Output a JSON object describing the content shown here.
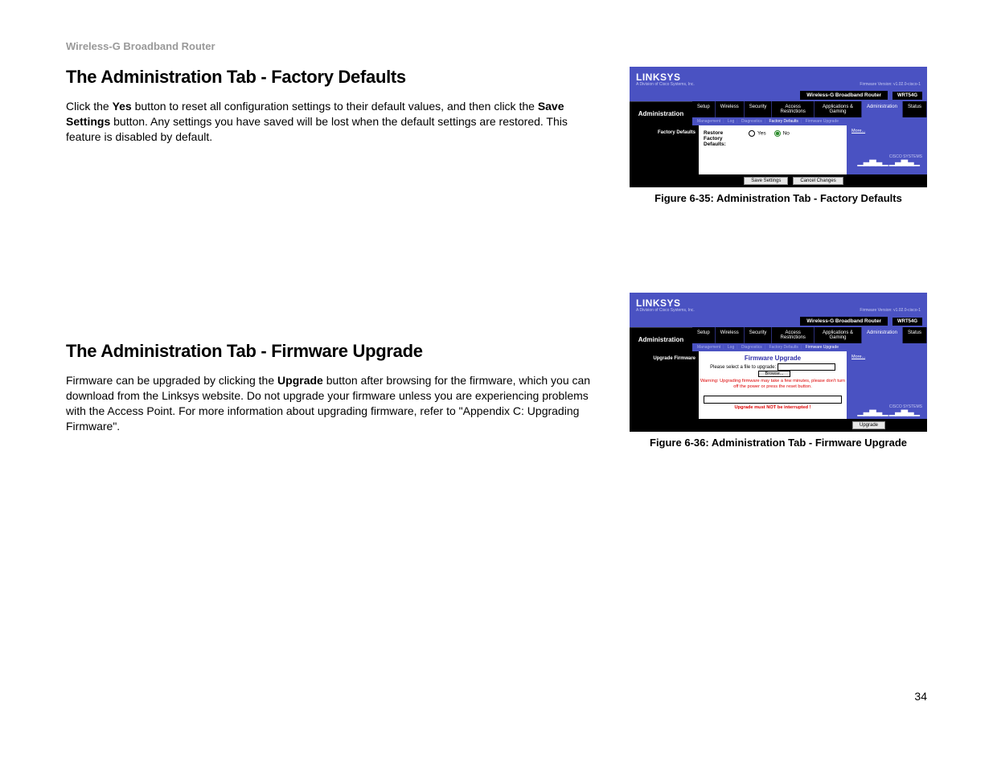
{
  "doc_header": "Wireless-G Broadband Router",
  "page_number": "34",
  "section1": {
    "title": "The Administration Tab - Factory Defaults",
    "p_pre": "Click the ",
    "p_b1": "Yes",
    "p_mid1": " button to reset all configuration settings to their default values, and then click the ",
    "p_b2": "Save Settings",
    "p_mid2": " button. Any settings you have saved will be lost when the default settings are restored. This feature is disabled by default."
  },
  "section2": {
    "title": "The Administration Tab - Firmware Upgrade",
    "p_pre": "Firmware can be upgraded by clicking the ",
    "p_b1": "Upgrade",
    "p_post": " button after browsing for the firmware, which you can download from the Linksys website. Do not upgrade your firmware unless you are experiencing problems with the Access Point. For more information about upgrading firmware, refer to \"Appendix C: Upgrading Firmware\"."
  },
  "fig1": {
    "caption": "Figure 6-35: Administration Tab - Factory Defaults",
    "logo": "LINKSYS",
    "logo_sub": "A Division of Cisco Systems, Inc.",
    "fw_ver": "Firmware Version: v1.02.0-cisco-1",
    "product": "Wireless-G Broadband Router",
    "model": "WRT54G",
    "left_main": "Administration",
    "tabs": [
      "Setup",
      "Wireless",
      "Security",
      "Access Restrictions",
      "Applications & Gaming",
      "Administration",
      "Status"
    ],
    "subtabs": [
      "Management",
      "Log",
      "Diagnostics",
      "Factory Defaults",
      "Firmware Upgrade"
    ],
    "sub_active": "Factory Defaults",
    "left_panel": "Factory Defaults",
    "row_label": "Restore Factory Defaults:",
    "opt_yes": "Yes",
    "opt_no": "No",
    "more": "More...",
    "save": "Save Settings",
    "cancel": "Cancel Changes",
    "cisco": "CISCO SYSTEMS"
  },
  "fig2": {
    "caption": "Figure 6-36: Administration Tab - Firmware Upgrade",
    "logo": "LINKSYS",
    "logo_sub": "A Division of Cisco Systems, Inc.",
    "fw_ver": "Firmware Version: v1.02.0-cisco-1",
    "product": "Wireless-G Broadband Router",
    "model": "WRT54G",
    "left_main": "Administration",
    "tabs": [
      "Setup",
      "Wireless",
      "Security",
      "Access Restrictions",
      "Applications & Gaming",
      "Administration",
      "Status"
    ],
    "subtabs": [
      "Management",
      "Log",
      "Diagnostics",
      "Factory Defaults",
      "Firmware Upgrade"
    ],
    "sub_active": "Firmware Upgrade",
    "left_panel": "Upgrade Firmware",
    "panel_title": "Firmware Upgrade",
    "select_label": "Please select a file to upgrade:",
    "browse": "Browse...",
    "warning": "Warning: Upgrading firmware may take a few minutes, please don't turn off the power or press the reset button.",
    "warning2": "Upgrade must NOT be interrupted !",
    "upgrade": "Upgrade",
    "more": "More...",
    "cisco": "CISCO SYSTEMS"
  }
}
